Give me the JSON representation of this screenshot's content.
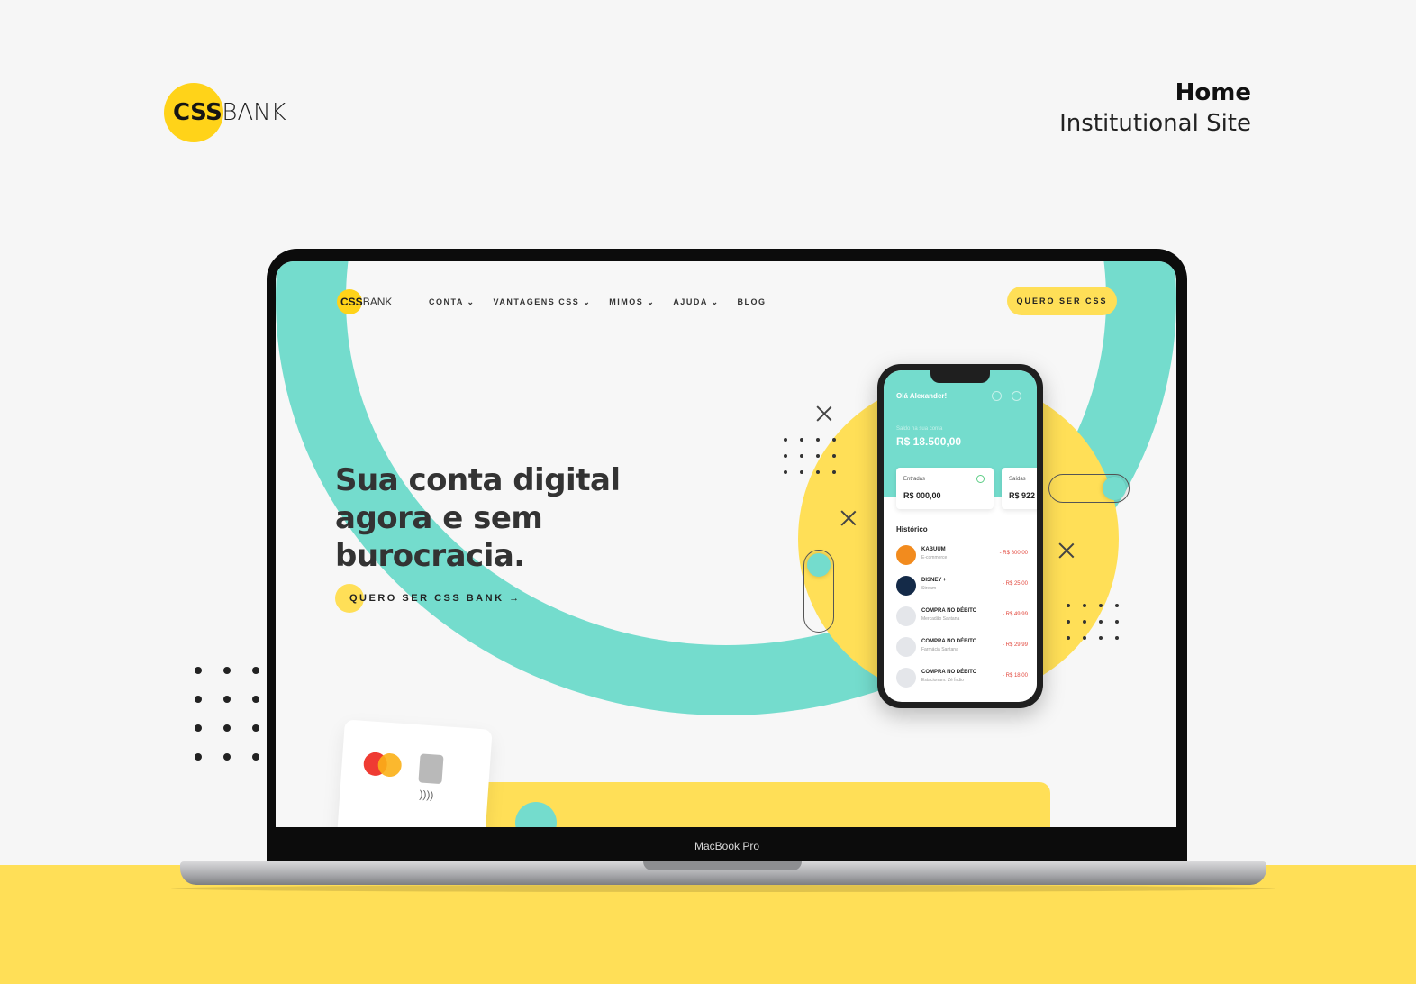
{
  "presentation": {
    "logo_css": "CSS",
    "logo_bank": "BANK",
    "title": "Home",
    "subtitle": "Institutional Site",
    "device_label": "MacBook Pro"
  },
  "site": {
    "logo_css": "CSS",
    "logo_bank": "BANK",
    "nav": [
      {
        "label": "CONTA ⌄"
      },
      {
        "label": "VANTAGENS CSS ⌄"
      },
      {
        "label": "MIMOS ⌄"
      },
      {
        "label": "AJUDA ⌄"
      },
      {
        "label": "BLOG"
      }
    ],
    "cta_top": "QUERO SER CSS",
    "hero_title_line1": "Sua conta digital",
    "hero_title_line2": "agora e sem",
    "hero_title_line3": "burocracia.",
    "hero_cta": "QUERO SER CSS BANK →"
  },
  "phone": {
    "greeting": "Olá Alexander!",
    "balance_label": "Saldo na sua conta",
    "balance": "R$ 18.500,00",
    "in_label": "Entradas",
    "in_value": "R$ 000,00",
    "out_label": "Saídas",
    "out_value": "R$ 922",
    "history_title": "Histórico",
    "transactions": [
      {
        "name": "KABUUM",
        "desc": "E-commerce",
        "amount": "- R$ 800,00",
        "color": "#f28b1e"
      },
      {
        "name": "DISNEY +",
        "desc": "Stream",
        "amount": "- R$ 25,00",
        "color": "#142a48"
      },
      {
        "name": "COMPRA NO DÉBITO",
        "desc": "Mercadão Santana",
        "amount": "- R$ 49,99",
        "color": "#e4e6ea"
      },
      {
        "name": "COMPRA NO DÉBITO",
        "desc": "Farmácia Santana",
        "amount": "- R$ 29,99",
        "color": "#e4e6ea"
      },
      {
        "name": "COMPRA NO DÉBITO",
        "desc": "Estacionam. Zé Índio",
        "amount": "- R$ 18,00",
        "color": "#e4e6ea"
      }
    ]
  },
  "colors": {
    "accent_yellow": "#ffdf57",
    "accent_teal": "#74dccd",
    "logo_yellow": "#ffd319"
  }
}
